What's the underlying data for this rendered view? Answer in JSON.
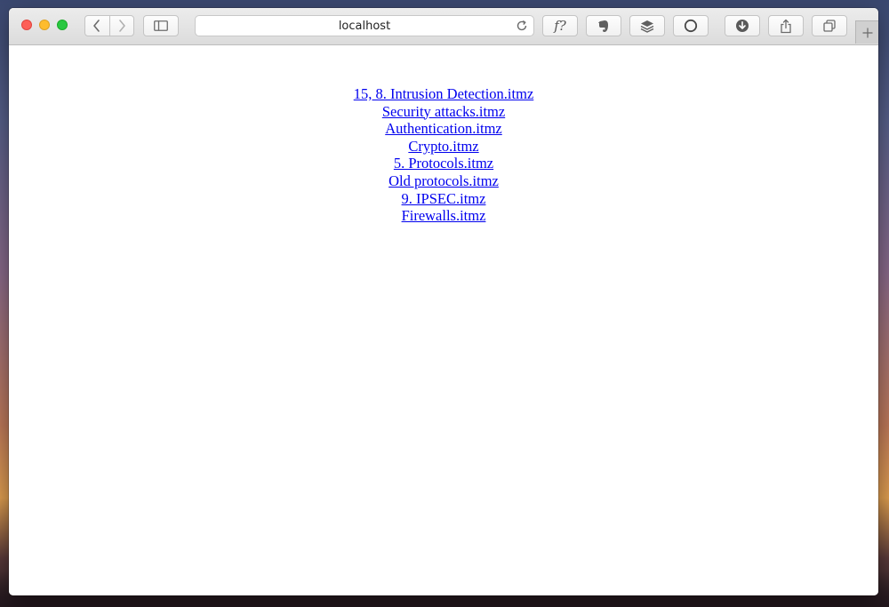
{
  "browser": {
    "address": "localhost",
    "format_button_label": "f?"
  },
  "page": {
    "links": [
      "15, 8. Intrusion Detection.itmz",
      "Security attacks.itmz",
      "Authentication.itmz",
      "Crypto.itmz",
      "5. Protocols.itmz",
      "Old protocols.itmz",
      "9. IPSEC.itmz",
      "Firewalls.itmz"
    ]
  },
  "icons": {
    "close": "close-icon",
    "minimize": "minimize-icon",
    "zoom": "zoom-icon",
    "back": "chevron-left-icon",
    "forward": "chevron-right-icon",
    "sidebar": "sidebar-icon",
    "reload": "reload-icon",
    "evernote": "evernote-icon",
    "layers": "layers-icon",
    "circle": "circle-icon",
    "download": "download-icon",
    "share": "share-icon",
    "tabs": "tabs-icon",
    "new_tab": "plus-icon"
  },
  "colors": {
    "link": "#0000ee",
    "close": "#fd5f57",
    "minimize": "#febc2e",
    "zoom": "#28c840"
  }
}
